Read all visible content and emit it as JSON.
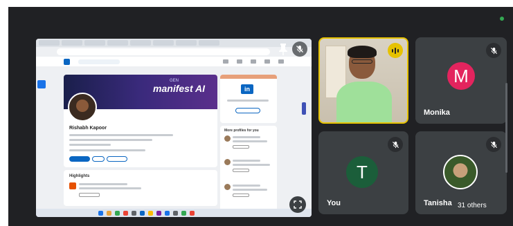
{
  "shared_screen": {
    "banner_brand": "manifest AI",
    "banner_sub": "GEN",
    "profile_name": "Rishabh Kapoor",
    "highlights_title": "Highlights",
    "people_title": "More profiles for you",
    "ad_logo": "in"
  },
  "participants": [
    {
      "name": "Monika",
      "initial": "M",
      "color": "#e3245e",
      "muted": true
    },
    {
      "name": "You",
      "initial": "T",
      "color": "#1b5e3a",
      "muted": true
    },
    {
      "name": "Tanisha",
      "muted": true
    }
  ],
  "others_label": "31 others",
  "colors": {
    "background": "#202124",
    "tile": "#3c4043",
    "speaking": "#e6c200"
  }
}
